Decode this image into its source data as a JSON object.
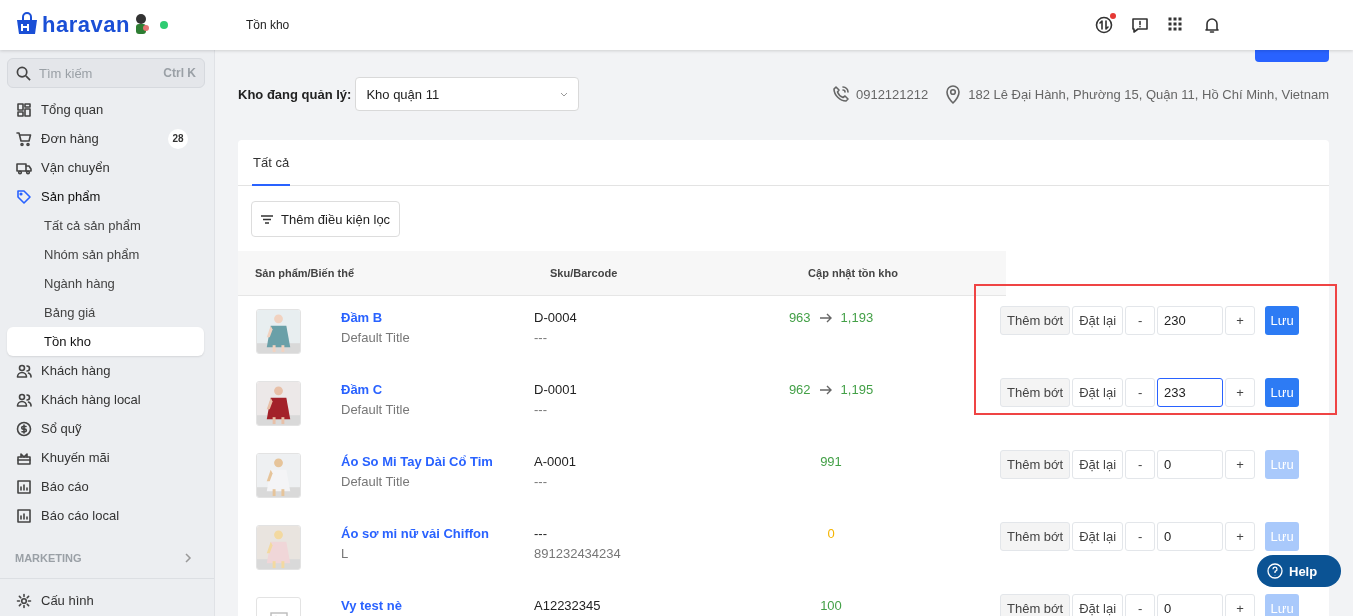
{
  "topbar": {
    "logo": "haravan",
    "online": true,
    "page_title": "Tồn kho",
    "notification_dot": true
  },
  "sidebar": {
    "search": {
      "placeholder": "Tìm kiếm",
      "shortcut": "Ctrl K"
    },
    "items": [
      {
        "label": "Tổng quan",
        "selected": false
      },
      {
        "label": "Đơn hàng",
        "selected": false,
        "badge": "28"
      },
      {
        "label": "Vận chuyển",
        "selected": false
      },
      {
        "label": "Sản phẩm",
        "selected": false,
        "expanded": true,
        "children": [
          {
            "label": "Tất cả sản phẩm",
            "selected": false
          },
          {
            "label": "Nhóm sản phẩm",
            "selected": false
          },
          {
            "label": "Ngành hàng",
            "selected": false
          },
          {
            "label": "Bảng giá",
            "selected": false
          },
          {
            "label": "Tồn kho",
            "selected": true
          }
        ]
      },
      {
        "label": "Khách hàng",
        "selected": false
      },
      {
        "label": "Khách hàng local",
        "selected": false
      },
      {
        "label": "Sổ quỹ",
        "selected": false
      },
      {
        "label": "Khuyến mãi",
        "selected": false
      },
      {
        "label": "Báo cáo",
        "selected": false
      },
      {
        "label": "Báo cáo local",
        "selected": false
      }
    ],
    "section": "MARKETING",
    "footer_item": {
      "label": "Cấu hình"
    }
  },
  "warehouse": {
    "label": "Kho đang quản lý:",
    "value": "Kho quận 11",
    "phone": "0912121212",
    "address": "182 Lê Đại Hành, Phường 15, Quận 11, Hồ Chí Minh, Vietnam"
  },
  "tabs": [
    {
      "label": "Tất cả",
      "selected": true
    }
  ],
  "filter_button": "Thêm điều kiện lọc",
  "table": {
    "columns": [
      "Sản phẩm/Biến thể",
      "Sku/Barcode",
      "Cập nhật tồn kho"
    ],
    "rows": [
      {
        "name": "Đầm B",
        "variant": "Default Title",
        "sku": "D-0004",
        "barcode": "---",
        "stock": "963",
        "new_stock": "1,193",
        "color": "#43a047",
        "mode_labels": [
          "Thêm bớt",
          "Đặt lại"
        ],
        "minus": "-",
        "quantity": "230",
        "plus": "+",
        "save": "Lưu",
        "save_enabled": true,
        "focused": false,
        "highlighted": true,
        "kind": "picture"
      },
      {
        "name": "Đầm C",
        "variant": "Default Title",
        "sku": "D-0001",
        "barcode": "---",
        "stock": "962",
        "new_stock": "1,195",
        "color": "#43a047",
        "mode_labels": [
          "Thêm bớt",
          "Đặt lại"
        ],
        "minus": "-",
        "quantity": "233",
        "plus": "+",
        "save": "Lưu",
        "save_enabled": true,
        "focused": true,
        "highlighted": true,
        "kind": "picture"
      },
      {
        "name": "Áo So Mi Tay Dài Cổ Tim",
        "variant": "Default Title",
        "sku": "A-0001",
        "barcode": "---",
        "stock": "991",
        "color": "#43a047",
        "mode_labels": [
          "Thêm bớt",
          "Đặt lại"
        ],
        "minus": "-",
        "quantity": "0",
        "plus": "+",
        "save": "Lưu",
        "save_enabled": false,
        "focused": false,
        "highlighted": false,
        "kind": "picture"
      },
      {
        "name": "Áo sơ mi nữ vải Chiffon",
        "variant": "L",
        "sku": "---",
        "barcode": "891232434234",
        "stock": "0",
        "color": "#f5b400",
        "mode_labels": [
          "Thêm bớt",
          "Đặt lại"
        ],
        "minus": "-",
        "quantity": "0",
        "plus": "+",
        "save": "Lưu",
        "save_enabled": false,
        "focused": false,
        "highlighted": false,
        "kind": "picture"
      },
      {
        "name": "Vy test nè",
        "sku": "A12232345",
        "stock": "100",
        "color": "#43a047",
        "mode_labels": [
          "Thêm bớt",
          "Đặt lại"
        ],
        "minus": "-",
        "quantity": "0",
        "plus": "+",
        "save": "Lưu",
        "save_enabled": false,
        "focused": false,
        "highlighted": false,
        "kind": "placeholder"
      }
    ]
  },
  "help_button": "Help"
}
